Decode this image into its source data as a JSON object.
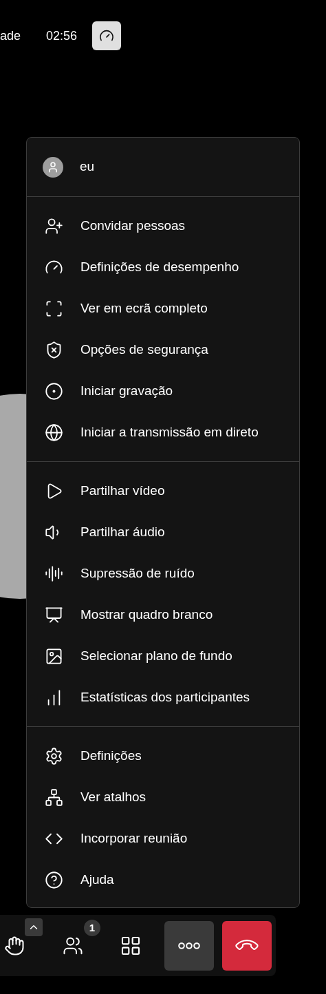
{
  "top_bar": {
    "partial_label": "ade",
    "timer": "02:56"
  },
  "menu": {
    "user": {
      "name": "eu"
    },
    "groups": [
      [
        {
          "label": "Convidar pessoas"
        },
        {
          "label": "Definições de desempenho"
        },
        {
          "label": "Ver em ecrã completo"
        },
        {
          "label": "Opções de segurança"
        },
        {
          "label": "Iniciar gravação"
        },
        {
          "label": "Iniciar a transmissão em direto"
        }
      ],
      [
        {
          "label": "Partilhar vídeo"
        },
        {
          "label": "Partilhar áudio"
        },
        {
          "label": "Supressão de ruído"
        },
        {
          "label": "Mostrar quadro branco"
        },
        {
          "label": "Selecionar plano de fundo"
        },
        {
          "label": "Estatísticas dos participantes"
        }
      ],
      [
        {
          "label": "Definições"
        },
        {
          "label": "Ver atalhos"
        },
        {
          "label": "Incorporar reunião"
        },
        {
          "label": "Ajuda"
        }
      ]
    ]
  },
  "toolbar": {
    "participants_count": "1",
    "more_selected": true
  }
}
